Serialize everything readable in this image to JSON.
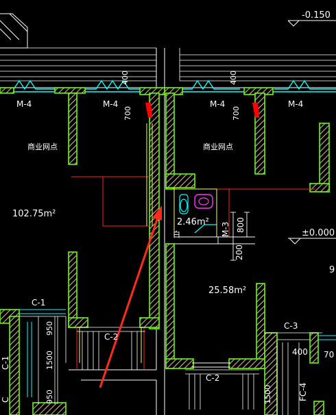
{
  "colors": {
    "background": "#000000",
    "wall_fill": "#d2b48c",
    "wall_border": "#66ff00",
    "line_white": "#ffffff",
    "line_red": "#ff2222",
    "line_cyan": "#00ffff",
    "line_yellow": "#ffff66",
    "line_magenta": "#ff33ff",
    "arrow": "#ff2a1a",
    "door_red": "#ff0000"
  },
  "elevations": {
    "top_right": "-0.150",
    "right_mid": "±0.000"
  },
  "doors": {
    "m4_a": "M-4",
    "m4_b": "M-4",
    "m4_c": "M-4",
    "m4_d": "M-4",
    "m3": "M-3"
  },
  "windows": {
    "c1_top": "C-1",
    "c1_side": "C-1",
    "c2_left": "C-2",
    "c2_mid": "C-2",
    "c3": "C-3",
    "fc4": "FC-4",
    "c_partial": "C"
  },
  "dimensions": {
    "d400_left": "400",
    "d700_left": "700",
    "d400_right": "400",
    "d700_right": "700",
    "d800": "800",
    "d200": "200",
    "d950_top": "950",
    "d1500_left": "1500",
    "d950_bottom": "950",
    "d1500_right": "1500",
    "d400_bottom": "400",
    "d70_partial": "70",
    "d9_partial": "9"
  },
  "rooms": {
    "shop_left": "商业网点",
    "shop_right": "商业网点",
    "area_left": "102.75m²",
    "area_toilet": "2.46m²",
    "area_right": "25.58m²",
    "toilet_tag": "白"
  }
}
